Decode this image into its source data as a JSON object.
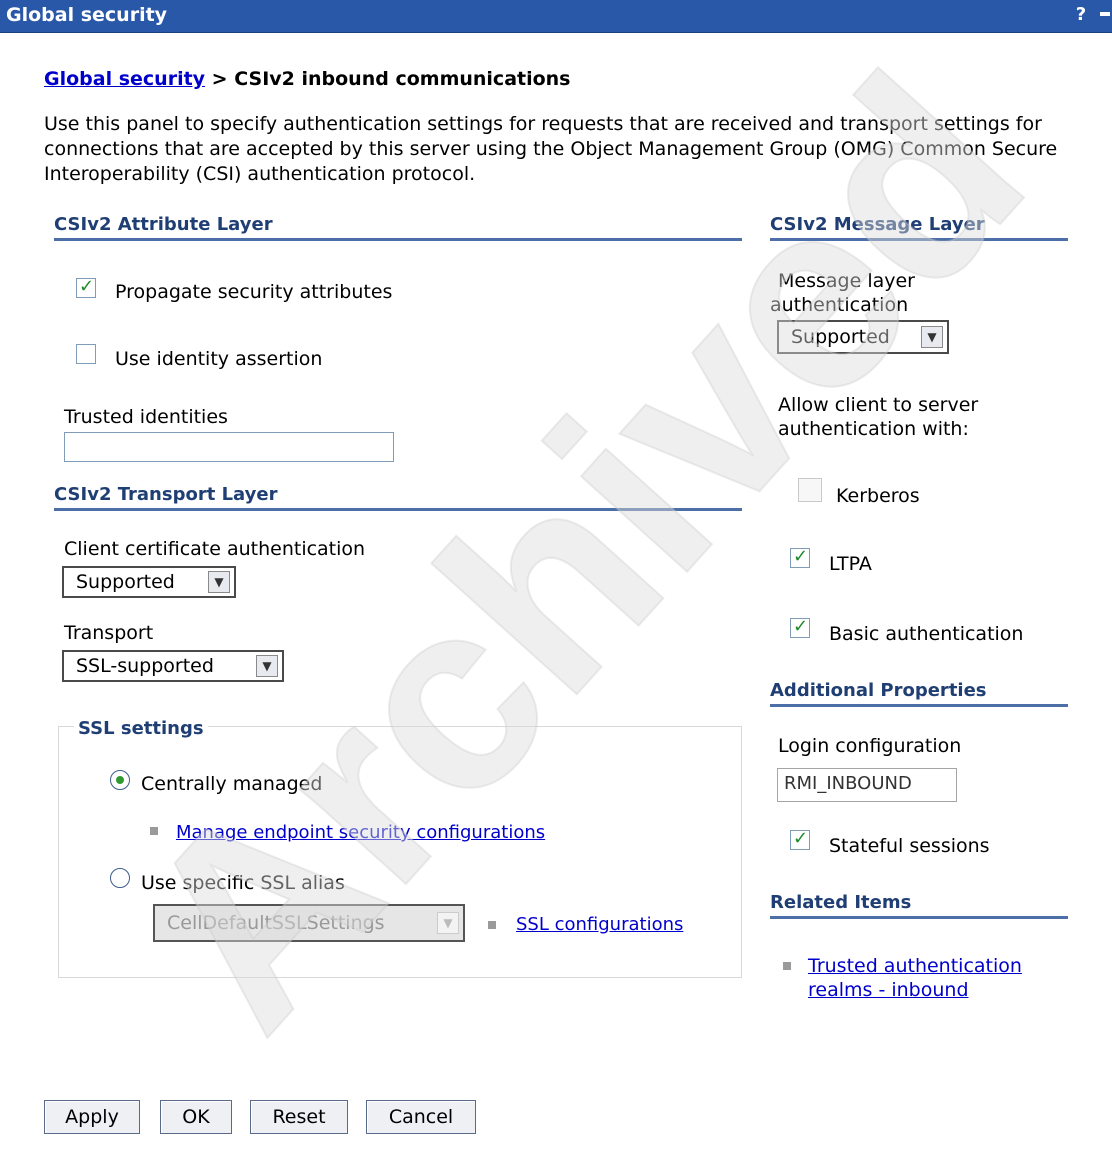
{
  "window": {
    "title": "Global security",
    "help_label": "?"
  },
  "breadcrumb": {
    "link_label": "Global security",
    "separator": ">",
    "current": "CSIv2 inbound communications"
  },
  "description": "Use this panel to specify authentication settings for requests that are received and transport settings for connections that are accepted by this server using the Object Management Group (OMG) Common Secure Interoperability (CSI) authentication protocol.",
  "attribute_layer": {
    "heading": "CSIv2 Attribute Layer",
    "propagate_label": "Propagate security attributes",
    "propagate_checked": true,
    "identity_assertion_label": "Use identity assertion",
    "identity_assertion_checked": false,
    "trusted_identities_label": "Trusted identities",
    "trusted_identities_value": ""
  },
  "transport_layer": {
    "heading": "CSIv2 Transport Layer",
    "client_cert_label": "Client certificate authentication",
    "client_cert_value": "Supported",
    "transport_label": "Transport",
    "transport_value": "SSL-supported",
    "ssl": {
      "legend": "SSL settings",
      "centrally_managed_label": "Centrally managed",
      "centrally_managed_selected": true,
      "manage_endpoint_link": "Manage endpoint security configurations",
      "specific_alias_label": "Use specific SSL alias",
      "specific_alias_selected": false,
      "alias_value": "CellDefaultSSLSettings",
      "ssl_config_link": "SSL configurations"
    }
  },
  "message_layer": {
    "heading": "CSIv2 Message Layer",
    "auth_label_line1": "Message layer",
    "auth_label_line2": "authentication",
    "auth_value": "Supported",
    "allow_label_line1": "Allow client to server",
    "allow_label_line2": "authentication with:",
    "kerberos_label": "Kerberos",
    "kerberos_checked": false,
    "ltpa_label": "LTPA",
    "ltpa_checked": true,
    "basic_auth_label": "Basic authentication",
    "basic_auth_checked": true
  },
  "additional_properties": {
    "heading": "Additional Properties",
    "login_config_label": "Login configuration",
    "login_config_value": "RMI_INBOUND",
    "stateful_label": "Stateful sessions",
    "stateful_checked": true
  },
  "related_items": {
    "heading": "Related Items",
    "link_line1": "Trusted authentication",
    "link_line2": "realms - inbound"
  },
  "buttons": {
    "apply": "Apply",
    "ok": "OK",
    "reset": "Reset",
    "cancel": "Cancel"
  },
  "watermark": {
    "text": "Archived",
    "color": "#dcdcdc"
  },
  "colors": {
    "title_bar": "#2a58a8",
    "section_heading": "#1f3e73",
    "link": "#0000cc"
  }
}
